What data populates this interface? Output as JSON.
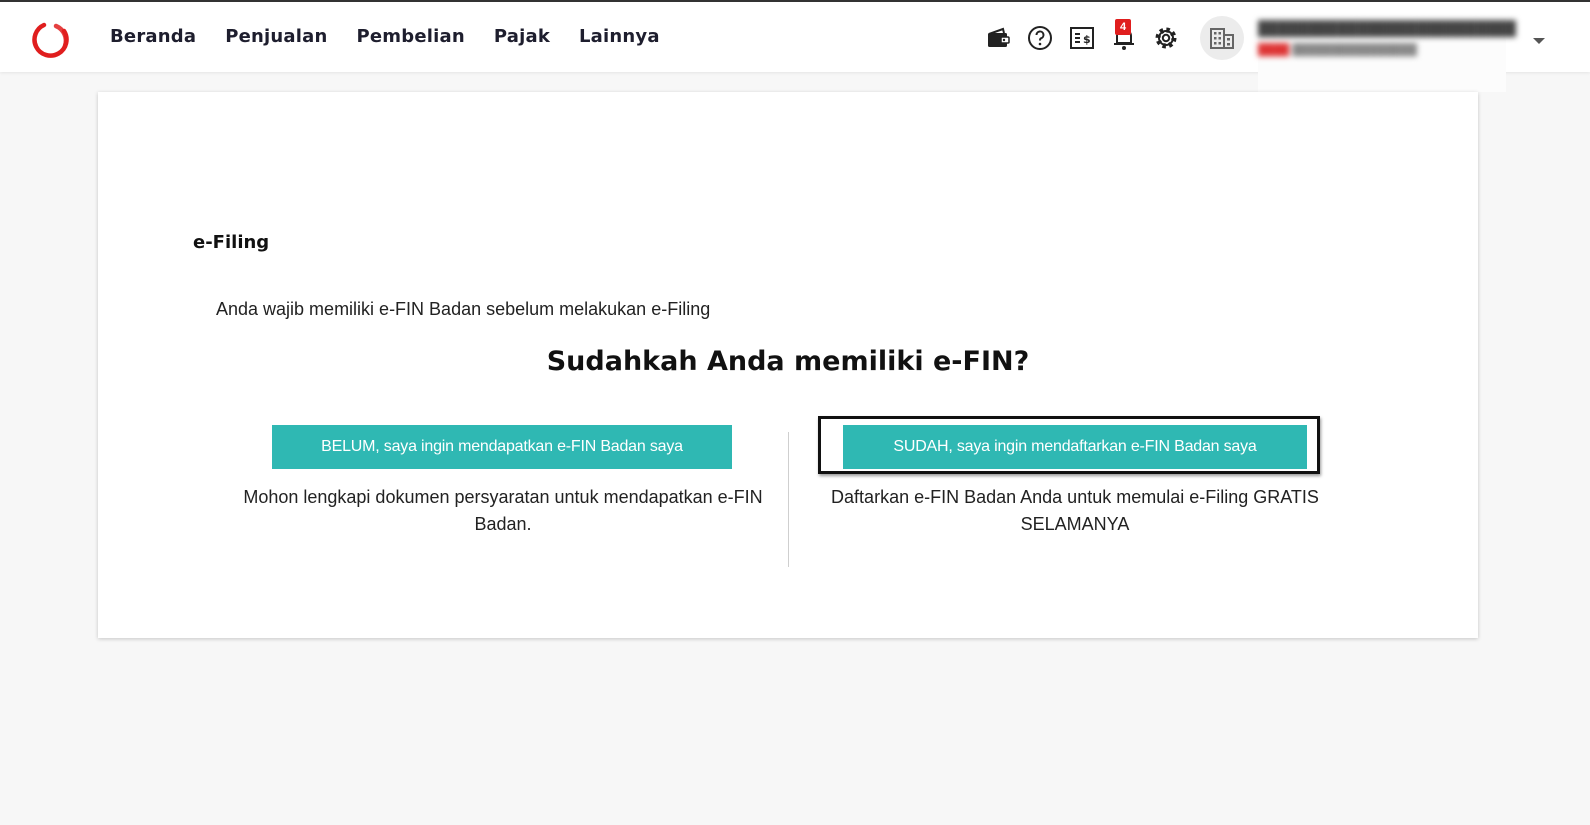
{
  "nav": {
    "items": [
      "Beranda",
      "Penjualan",
      "Pembelian",
      "Pajak",
      "Lainnya"
    ]
  },
  "header": {
    "icons": [
      "wallet-icon",
      "help-icon",
      "invoice-icon",
      "notification-icon",
      "settings-icon",
      "company-icon"
    ],
    "notification_count": "4"
  },
  "main": {
    "title": "e-Filing",
    "intro": "Anda wajib memiliki e-FIN Badan sebelum melakukan e-Filing",
    "question": "Sudahkah Anda memiliki e-FIN?",
    "left": {
      "button": "BELUM, saya ingin mendapatkan e-FIN Badan saya",
      "desc": "Mohon lengkapi dokumen persyaratan untuk mendapatkan e-FIN Badan."
    },
    "right": {
      "button": "SUDAH, saya ingin mendaftarkan e-FIN Badan saya",
      "desc": "Daftarkan e-FIN Badan Anda untuk memulai e-Filing GRATIS SELAMANYA"
    }
  },
  "colors": {
    "accent": "#2fb8b3",
    "brand_red": "#e01e1e",
    "text": "#1e1e2e"
  }
}
